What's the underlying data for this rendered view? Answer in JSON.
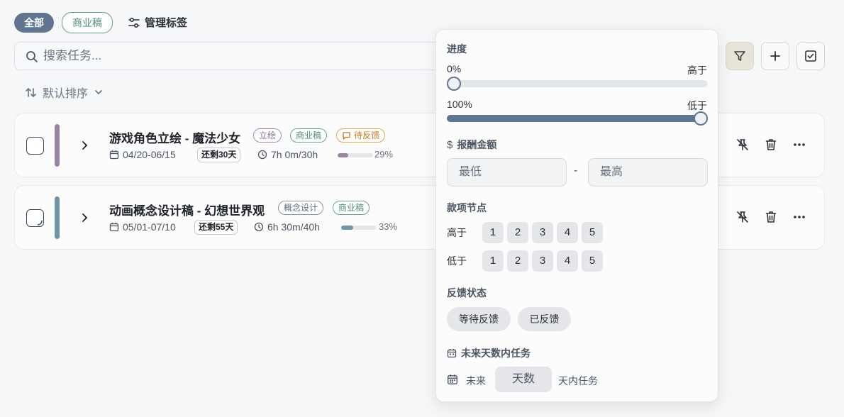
{
  "filters": {
    "all_label": "全部",
    "business_label": "商业稿",
    "manage_label": "管理标签"
  },
  "search": {
    "placeholder": "搜索任务..."
  },
  "sort": {
    "label": "默认排序"
  },
  "tasks": [
    {
      "title": "游戏角色立绘 - 魔法少女",
      "tags": [
        "立绘",
        "商业稿"
      ],
      "feedback_tag": "待反馈",
      "dates": "04/20-06/15",
      "remaining": "还剩30天",
      "time": "7h 0m/30h",
      "progress": 29,
      "progress_label": "29%",
      "bar_color": "#9a84a6",
      "progress_color": "#9a84a6"
    },
    {
      "title": "动画概念设计稿 - 幻想世界观",
      "tags": [
        "概念设计",
        "商业稿"
      ],
      "dates": "05/01-07/10",
      "remaining": "还剩55天",
      "time": "6h 30m/40h",
      "progress": 33,
      "progress_label": "33%",
      "bar_color": "#6f96a8",
      "progress_color": "#6f96a8"
    }
  ],
  "filter_panel": {
    "progress_title": "进度",
    "slider_min": {
      "value_label": "0%",
      "side_label": "高于",
      "value": 0
    },
    "slider_max": {
      "value_label": "100%",
      "side_label": "低于",
      "value": 100
    },
    "amount_title": "报酬金额",
    "amount_min_placeholder": "最低",
    "amount_max_placeholder": "最高",
    "amount_sep": "-",
    "milestone_title": "款项节点",
    "above_label": "高于",
    "below_label": "低于",
    "milestone_options": [
      "1",
      "2",
      "3",
      "4",
      "5"
    ],
    "feedback_title": "反馈状态",
    "feedback_options": [
      "等待反馈",
      "已反馈"
    ],
    "future_title": "未来天数内任务",
    "future_prefix": "未来",
    "future_placeholder": "天数",
    "future_suffix": "天内任务"
  }
}
